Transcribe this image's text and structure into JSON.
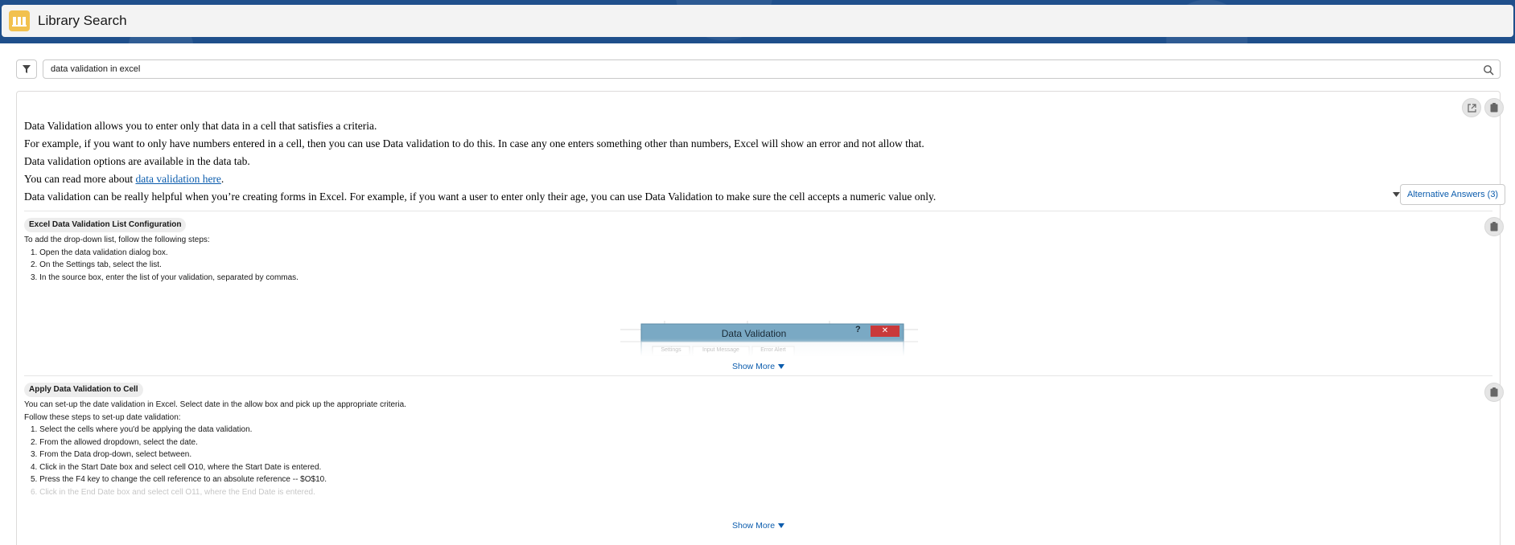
{
  "header": {
    "title": "Library Search"
  },
  "search": {
    "value": "data validation in excel"
  },
  "answer": {
    "lines": [
      "Data Validation allows you to enter only that data in a cell that satisfies a criteria.",
      "For example, if you want to only have numbers entered in a cell, then you can use Data validation to do this. In case any one enters something other than numbers, Excel will show an error and not allow that.",
      "Data validation options are available in the data tab."
    ],
    "read_more_prefix": "You can read more about ",
    "read_more_link": "data validation here",
    "read_more_suffix": ".",
    "last_line": "Data validation can be really helpful when you’re creating forms in Excel. For example, if you want a user to enter only their age, you can use Data Validation to make sure the cell accepts a numeric value only."
  },
  "alt_answers_label": "Alternative Answers (3)",
  "sections": [
    {
      "title": "Excel Data Validation List Configuration",
      "intro": "To add the drop-down list, follow the following steps:",
      "steps": [
        "1. Open the data validation dialog box.",
        "2. On the Settings tab, select the list.",
        "3. In the source box, enter the list of your validation, separated by commas."
      ],
      "preview": {
        "dialog_title": "Data Validation",
        "help": "?",
        "close": "✕",
        "tabs": [
          "Settings",
          "Input Message",
          "Error Alert"
        ]
      },
      "show_more": "Show More"
    },
    {
      "title": "Apply Data Validation to Cell",
      "intro": "You can set-up the date validation in Excel. Select date in the allow box and pick up the appropriate criteria.",
      "intro2": "Follow these steps to set-up date validation:",
      "steps": [
        "1. Select the cells where you'd be applying the data validation.",
        "2. From the allowed dropdown, select the date.",
        "3. From the Data drop-down, select between.",
        "4. Click in the Start Date box and select cell O10, where the Start Date is entered.",
        "5. Press the F4 key to change the cell reference to an absolute reference -- $O$10.",
        "6. Click in the End Date box and select cell O11, where the End Date is entered."
      ],
      "show_more": "Show More"
    }
  ]
}
